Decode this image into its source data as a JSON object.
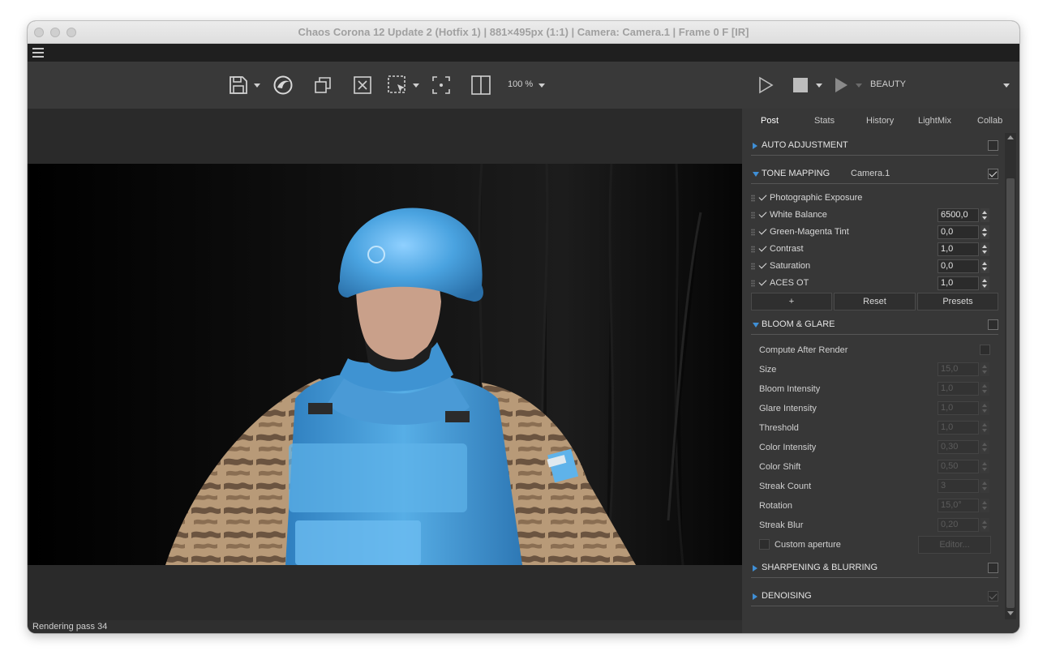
{
  "window": {
    "title": "Chaos Corona 12 Update 2 (Hotfix 1) | 881×495px (1:1) | Camera: Camera.1 | Frame 0 F [IR]"
  },
  "toolbar": {
    "zoom": "100 %",
    "render_element": "BEAUTY",
    "icons": [
      "save-icon",
      "corona-logo-icon",
      "copy-icon",
      "clear-icon",
      "region-select-icon",
      "focus-icon",
      "compare-icon",
      "play-icon",
      "stop-icon",
      "resume-icon"
    ]
  },
  "panel": {
    "tabs": [
      "Post",
      "Stats",
      "History",
      "LightMix",
      "Collab"
    ],
    "auto_adjustment": {
      "label": "AUTO ADJUSTMENT",
      "checked": false
    },
    "tone_mapping": {
      "label": "TONE MAPPING",
      "camera": "Camera.1",
      "checked": true,
      "operators": [
        {
          "label": "Photographic Exposure",
          "value": null
        },
        {
          "label": "White Balance",
          "value": "6500,0"
        },
        {
          "label": "Green-Magenta Tint",
          "value": "0,0"
        },
        {
          "label": "Contrast",
          "value": "1,0"
        },
        {
          "label": "Saturation",
          "value": "0,0"
        },
        {
          "label": "ACES OT",
          "value": "1,0"
        }
      ],
      "buttons": {
        "add": "+",
        "reset": "Reset",
        "presets": "Presets"
      }
    },
    "bloom_glare": {
      "label": "BLOOM & GLARE",
      "checked": false,
      "compute_after_render": "Compute After Render",
      "params": [
        {
          "label": "Size",
          "value": "15,0"
        },
        {
          "label": "Bloom Intensity",
          "value": "1,0"
        },
        {
          "label": "Glare Intensity",
          "value": "1,0"
        },
        {
          "label": "Threshold",
          "value": "1,0"
        },
        {
          "label": "Color Intensity",
          "value": "0,30"
        },
        {
          "label": "Color Shift",
          "value": "0,50"
        },
        {
          "label": "Streak Count",
          "value": "3"
        },
        {
          "label": "Rotation",
          "value": "15,0°"
        },
        {
          "label": "Streak Blur",
          "value": "0,20"
        }
      ],
      "custom_aperture": "Custom aperture",
      "editor": "Editor..."
    },
    "sharpening": {
      "label": "SHARPENING & BLURRING",
      "checked": false
    },
    "denoising": {
      "label": "DENOISING",
      "checked": true
    }
  },
  "status": {
    "text": "Rendering pass 34"
  },
  "colors": {
    "accent": "#3f8fd6",
    "helmet": "#4aa3e0",
    "vest": "#4d9fda"
  }
}
